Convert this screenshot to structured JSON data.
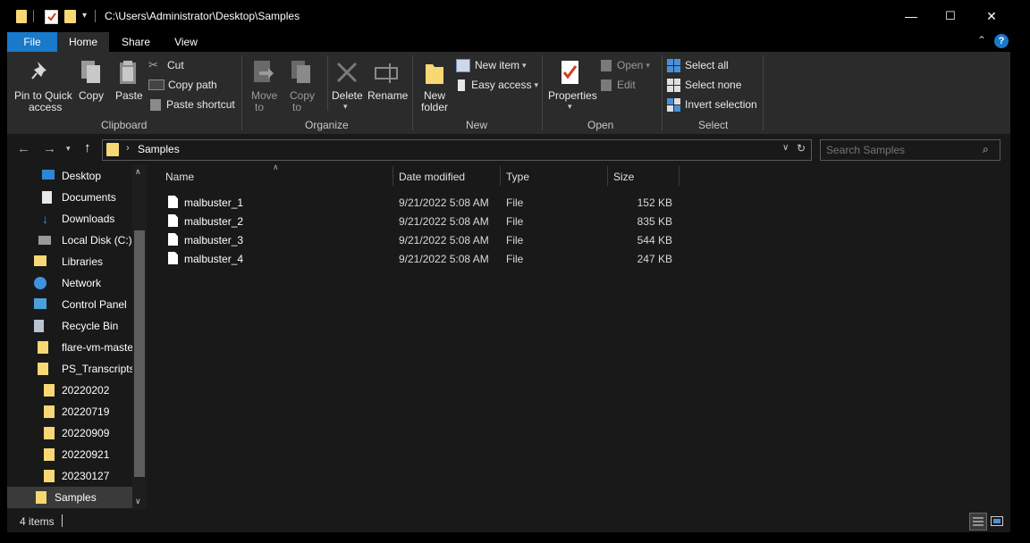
{
  "window": {
    "path_title": "C:\\Users\\Administrator\\Desktop\\Samples",
    "minimize_glyph": "—",
    "maximize_glyph": "☐",
    "close_glyph": "✕"
  },
  "tabs": [
    {
      "label": "File"
    },
    {
      "label": "Home"
    },
    {
      "label": "Share"
    },
    {
      "label": "View"
    }
  ],
  "ribbon": {
    "clipboard": {
      "group_label": "Clipboard",
      "pin_label_1": "Pin to Quick",
      "pin_label_2": "access",
      "copy_label": "Copy",
      "paste_label": "Paste",
      "cut_label": "Cut",
      "copy_path_label": "Copy path",
      "paste_shortcut_label": "Paste shortcut"
    },
    "organize": {
      "group_label": "Organize",
      "move_label_1": "Move",
      "move_label_2": "to",
      "copy_label_1": "Copy",
      "copy_label_2": "to",
      "delete_label": "Delete",
      "rename_label": "Rename"
    },
    "new": {
      "group_label": "New",
      "new_folder_1": "New",
      "new_folder_2": "folder",
      "new_item_label": "New item",
      "easy_access_label": "Easy access"
    },
    "open": {
      "group_label": "Open",
      "properties_label": "Properties",
      "open_label": "Open",
      "edit_label": "Edit"
    },
    "select": {
      "group_label": "Select",
      "select_all_label": "Select all",
      "select_none_label": "Select none",
      "invert_label": "Invert selection"
    }
  },
  "address": {
    "crumb": "Samples",
    "search_placeholder": "Search Samples"
  },
  "nav": [
    {
      "label": "Desktop",
      "icon": "desktop-icon"
    },
    {
      "label": "Documents",
      "icon": "documents-icon"
    },
    {
      "label": "Downloads",
      "icon": "downloads-icon"
    },
    {
      "label": "Local Disk (C:)",
      "icon": "drive-icon"
    },
    {
      "label": "Libraries",
      "icon": "libraries-icon"
    },
    {
      "label": "Network",
      "icon": "network-icon"
    },
    {
      "label": "Control Panel",
      "icon": "control-panel-icon"
    },
    {
      "label": "Recycle Bin",
      "icon": "recycle-bin-icon"
    },
    {
      "label": "flare-vm-master",
      "icon": "folder-icon"
    },
    {
      "label": "PS_Transcripts",
      "icon": "folder-icon"
    },
    {
      "label": "20220202",
      "icon": "folder-icon"
    },
    {
      "label": "20220719",
      "icon": "folder-icon"
    },
    {
      "label": "20220909",
      "icon": "folder-icon"
    },
    {
      "label": "20220921",
      "icon": "folder-icon"
    },
    {
      "label": "20230127",
      "icon": "folder-icon"
    },
    {
      "label": "Samples",
      "icon": "folder-icon"
    }
  ],
  "columns": {
    "name": "Name",
    "date": "Date modified",
    "type": "Type",
    "size": "Size"
  },
  "files": [
    {
      "name": "malbuster_1",
      "date": "9/21/2022 5:08 AM",
      "type": "File",
      "size": "152 KB"
    },
    {
      "name": "malbuster_2",
      "date": "9/21/2022 5:08 AM",
      "type": "File",
      "size": "835 KB"
    },
    {
      "name": "malbuster_3",
      "date": "9/21/2022 5:08 AM",
      "type": "File",
      "size": "544 KB"
    },
    {
      "name": "malbuster_4",
      "date": "9/21/2022 5:08 AM",
      "type": "File",
      "size": "247 KB"
    }
  ],
  "status": {
    "items_count": "4 items"
  },
  "colors": {
    "file_tab": "#1979ca",
    "folder": "#f8d775",
    "accent": "#1979ca"
  }
}
